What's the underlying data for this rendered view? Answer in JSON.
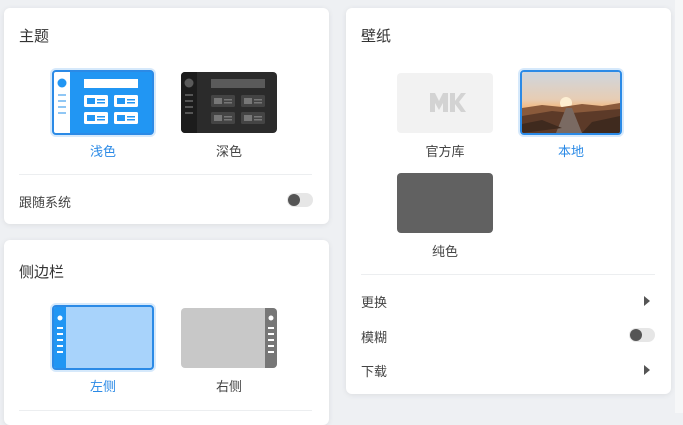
{
  "theme": {
    "title": "主题",
    "options": [
      {
        "label": "浅色",
        "selected": true
      },
      {
        "label": "深色",
        "selected": false
      }
    ],
    "follow_system": {
      "label": "跟随系统",
      "enabled": false
    }
  },
  "sidebar": {
    "title": "侧边栏",
    "options": [
      {
        "label": "左侧",
        "selected": true
      },
      {
        "label": "右侧",
        "selected": false
      }
    ]
  },
  "wallpaper": {
    "title": "壁纸",
    "options": [
      {
        "label": "官方库",
        "selected": false
      },
      {
        "label": "本地",
        "selected": true
      },
      {
        "label": "纯色",
        "selected": false
      }
    ],
    "rows": [
      {
        "label": "更换",
        "control": "arrow"
      },
      {
        "label": "模糊",
        "control": "toggle",
        "enabled": false
      },
      {
        "label": "下载",
        "control": "arrow"
      }
    ]
  },
  "colors": {
    "accent": "#2b8ae6",
    "light_theme_blue": "#2196f3",
    "dark_theme": "#2b2b2b",
    "sidebar_light": "#a8d3fb",
    "sidebar_gray": "#c8c8c8",
    "solid_wallpaper": "#616161"
  }
}
